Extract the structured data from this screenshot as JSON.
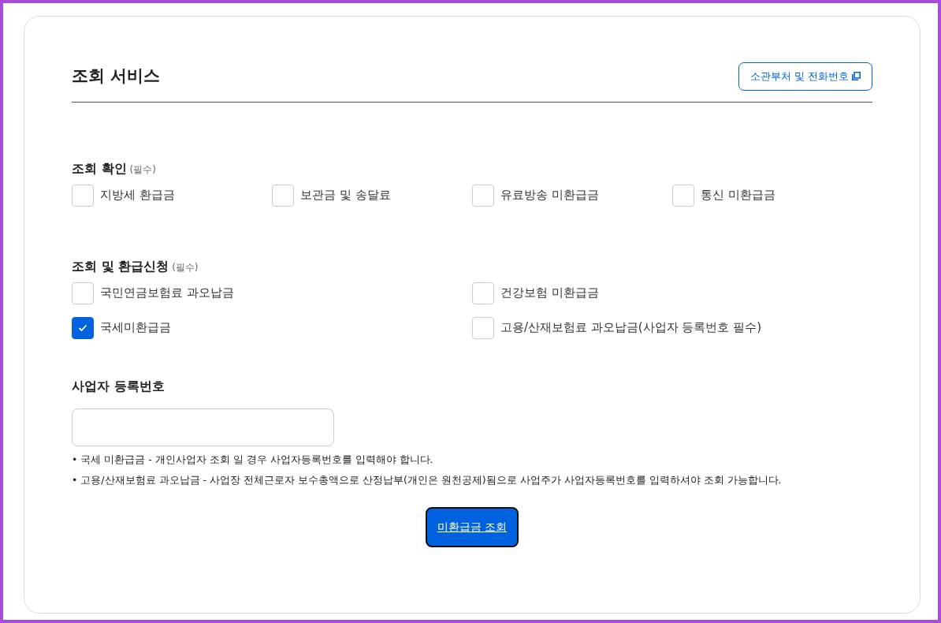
{
  "title": "조회 서비스",
  "header_link": {
    "label": "소관부처 및 전화번호"
  },
  "sections": [
    {
      "title": "조회 확인",
      "note": "(필수)",
      "kind": "four_column",
      "options": [
        {
          "label": "지방세 환급금",
          "checked": false
        },
        {
          "label": "보관금 및 송달료",
          "checked": false
        },
        {
          "label": "유료방송 미환급금",
          "checked": false
        },
        {
          "label": "통신 미환급금",
          "checked": false
        }
      ]
    },
    {
      "title": "조회 및 환급신청",
      "note": "(필수)",
      "kind": "two_column",
      "options": [
        {
          "label": "국민연금보험료 과오납금",
          "checked": false
        },
        {
          "label": "건강보험 미환급금",
          "checked": false
        },
        {
          "label": "국세미환급금",
          "checked": true
        },
        {
          "label": "고용/산재보험료 과오납금(사업자 등록번호 필수)",
          "checked": false
        }
      ]
    }
  ],
  "business_number": {
    "label": "사업자 등록번호"
  },
  "notes": [
    "• 국세 미환급금 - 개인사업자 조회 일 경우 사업자등록번호를 입력해야 합니다.",
    "• 고용/산재보험료 과오납금 - 사업장 전체근로자 보수총액으로 산정납부(개인은 원천공제)됨으로 사업주가 사업자등록번호를 입력하셔야 조회 가능합니다."
  ],
  "submit": {
    "label": "미환급금 조회"
  }
}
